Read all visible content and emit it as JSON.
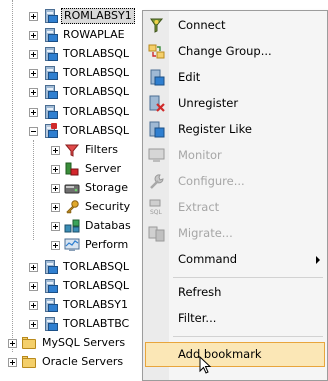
{
  "tree": {
    "server_nodes_top": [
      "ROMLABSY1",
      "ROWAPLAE",
      "TORLABSQL",
      "TORLABSQL",
      "TORLABSQL",
      "TORLABSQL"
    ],
    "expanded_server": "TORLABSQL",
    "children": [
      "Filters",
      "Server",
      "Storage",
      "Security",
      "Databas",
      "Perform"
    ],
    "server_nodes_bottom": [
      "TORLABSQL",
      "TORLABSQL",
      "TORLABSY1",
      "TORLABTBC"
    ],
    "groups": [
      "MySQL Servers",
      "Oracle Servers"
    ]
  },
  "menu": {
    "items": [
      {
        "label": "Connect",
        "icon": "connect-icon",
        "enabled": true
      },
      {
        "label": "Change Group...",
        "icon": "change-group-icon",
        "enabled": true
      },
      {
        "label": "Edit",
        "icon": "edit-icon",
        "enabled": true
      },
      {
        "label": "Unregister",
        "icon": "unregister-icon",
        "enabled": true
      },
      {
        "label": "Register Like",
        "icon": "register-like-icon",
        "enabled": true
      },
      {
        "label": "Monitor",
        "icon": "monitor-icon",
        "enabled": false
      },
      {
        "label": "Configure...",
        "icon": "configure-icon",
        "enabled": false
      },
      {
        "label": "Extract",
        "icon": "extract-icon",
        "enabled": false
      },
      {
        "label": "Migrate...",
        "icon": "migrate-icon",
        "enabled": false
      },
      {
        "label": "Command",
        "icon": "",
        "enabled": true,
        "submenu": true
      },
      {
        "label": "Refresh",
        "icon": "",
        "enabled": true
      },
      {
        "label": "Filter...",
        "icon": "",
        "enabled": true
      },
      {
        "label": "Add bookmark",
        "icon": "",
        "enabled": true,
        "highlighted": true
      }
    ]
  },
  "colors": {
    "menu_highlight": "#fbe7b6",
    "menu_highlight_border": "#e8a53c",
    "disabled_text": "#a6a6a6"
  }
}
